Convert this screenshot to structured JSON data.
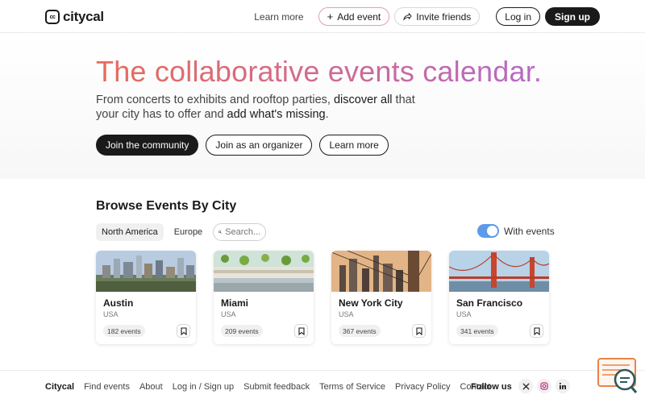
{
  "header": {
    "logo_text": "citycal",
    "logo_mark": "cc",
    "learn_more": "Learn more",
    "add_event": "Add event",
    "invite_friends": "Invite friends",
    "log_in": "Log in",
    "sign_up": "Sign up"
  },
  "hero": {
    "title": "The collaborative events calendar.",
    "subtitle_part1": "From concerts to exhibits and rooftop parties, ",
    "subtitle_emph1": "discover all",
    "subtitle_part2": " that your city has to offer and ",
    "subtitle_emph2": "add what's missing",
    "subtitle_part3": ".",
    "buttons": {
      "join_community": "Join the community",
      "join_organizer": "Join as an organizer",
      "learn_more": "Learn more"
    }
  },
  "browse": {
    "title": "Browse Events By City",
    "tabs": [
      "North America",
      "Europe"
    ],
    "search_placeholder": "Search...",
    "toggle_label": "With events",
    "toggle_on": true
  },
  "cities": [
    {
      "name": "Austin",
      "country": "USA",
      "count": "182 events"
    },
    {
      "name": "Miami",
      "country": "USA",
      "count": "209 events"
    },
    {
      "name": "New York City",
      "country": "USA",
      "count": "367 events"
    },
    {
      "name": "San Francisco",
      "country": "USA",
      "count": "341 events"
    }
  ],
  "footer": {
    "brand": "Citycal",
    "links": [
      "Find events",
      "About",
      "Log in / Sign up",
      "Submit feedback",
      "Terms of Service",
      "Privacy Policy",
      "Contact"
    ],
    "follow_us": "Follow us",
    "socials": [
      "x-icon",
      "instagram-icon",
      "linkedin-icon"
    ]
  },
  "colors": {
    "accent_toggle": "#5b9bea",
    "title_gradient_start": "#e86a5a",
    "title_gradient_end": "#b56ac8",
    "dark": "#1a1a1a",
    "instagram": "#c13584",
    "help_widget": "#e8834a"
  }
}
